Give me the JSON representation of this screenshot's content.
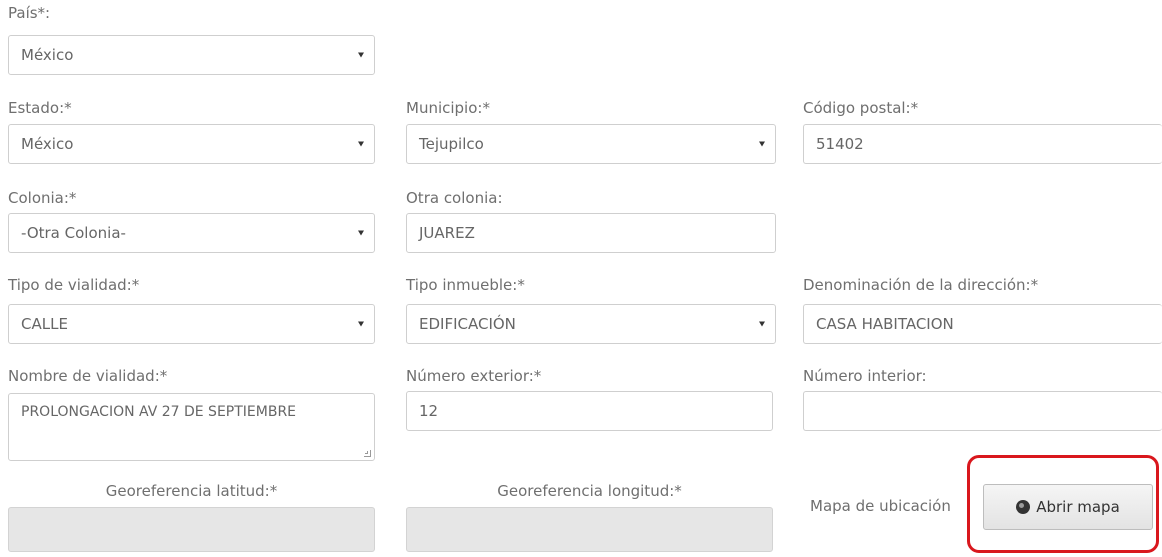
{
  "pais": {
    "label": "País*:",
    "value": "México"
  },
  "estado": {
    "label": "Estado:*",
    "value": "México"
  },
  "municipio": {
    "label": "Municipio:*",
    "value": "Tejupilco"
  },
  "codigo_postal": {
    "label": "Código postal:*",
    "value": "51402"
  },
  "colonia": {
    "label": "Colonia:*",
    "value": "-Otra Colonia-"
  },
  "otra_colonia": {
    "label": "Otra colonia:",
    "value": "JUAREZ"
  },
  "tipo_vialidad": {
    "label": "Tipo de vialidad:*",
    "value": "CALLE"
  },
  "tipo_inmueble": {
    "label": "Tipo inmueble:*",
    "value": "EDIFICACIÓN"
  },
  "denominacion": {
    "label": "Denominación de la dirección:*",
    "value": "CASA HABITACION"
  },
  "nombre_vialidad": {
    "label": "Nombre de vialidad:*",
    "value": "PROLONGACION AV 27 DE SEPTIEMBRE"
  },
  "numero_exterior": {
    "label": "Número exterior:*",
    "value": "12"
  },
  "numero_interior": {
    "label": "Número interior:",
    "value": ""
  },
  "latitud": {
    "label": "Georeferencia latitud:*",
    "value": ""
  },
  "longitud": {
    "label": "Georeferencia longitud:*",
    "value": ""
  },
  "mapa": {
    "label": "Mapa de ubicación",
    "button_label": "Abrir mapa",
    "icon": "globe-icon"
  },
  "colors": {
    "highlight": "#d9171d",
    "disabled_bg": "#e6e6e6"
  }
}
